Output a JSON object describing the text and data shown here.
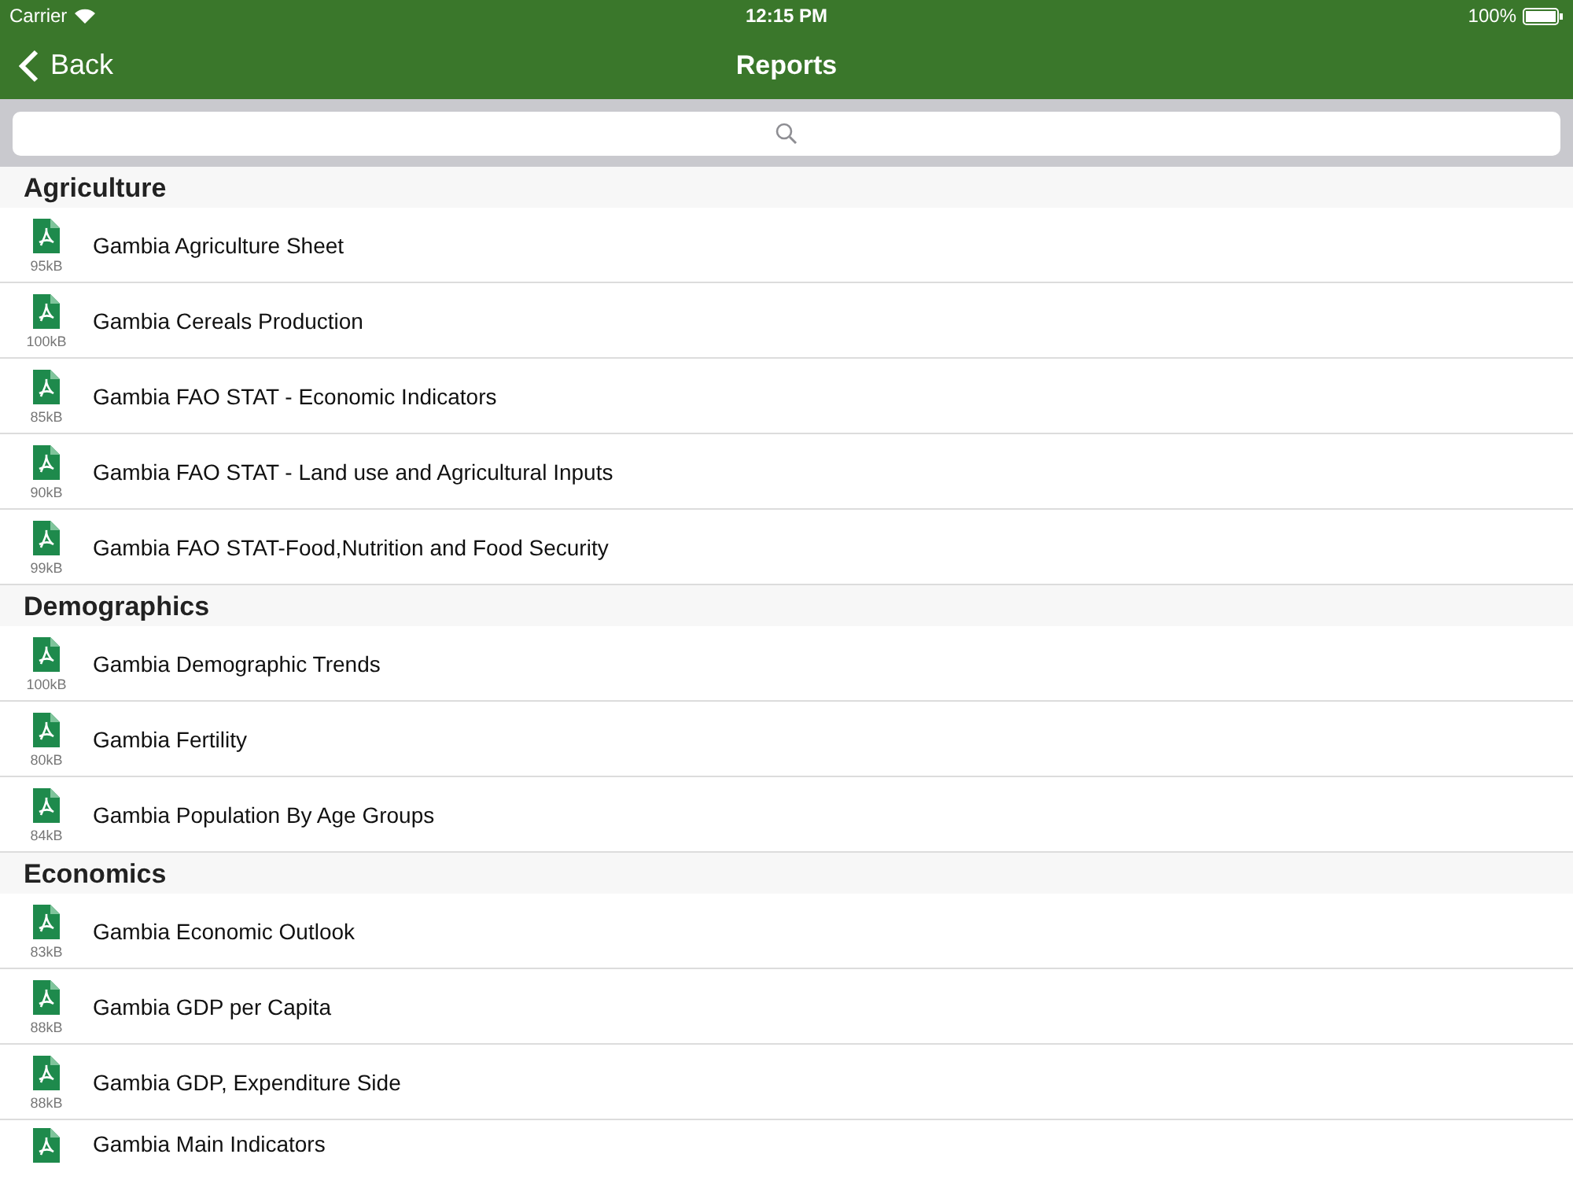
{
  "status_bar": {
    "carrier": "Carrier",
    "time": "12:15 PM",
    "battery": "100%"
  },
  "nav": {
    "back": "Back",
    "title": "Reports"
  },
  "sections": [
    {
      "title": "Agriculture",
      "items": [
        {
          "name": "Gambia Agriculture Sheet",
          "size": "95kB"
        },
        {
          "name": "Gambia Cereals Production",
          "size": "100kB"
        },
        {
          "name": "Gambia FAO STAT - Economic Indicators",
          "size": "85kB"
        },
        {
          "name": "Gambia FAO STAT - Land use and Agricultural Inputs",
          "size": "90kB"
        },
        {
          "name": "Gambia FAO STAT-Food,Nutrition and Food Security",
          "size": "99kB"
        }
      ]
    },
    {
      "title": "Demographics",
      "items": [
        {
          "name": "Gambia Demographic Trends",
          "size": "100kB"
        },
        {
          "name": "Gambia Fertility",
          "size": "80kB"
        },
        {
          "name": "Gambia Population By Age Groups",
          "size": "84kB"
        }
      ]
    },
    {
      "title": "Economics",
      "items": [
        {
          "name": "Gambia Economic Outlook",
          "size": "83kB"
        },
        {
          "name": "Gambia GDP per Capita",
          "size": "88kB"
        },
        {
          "name": "Gambia GDP, Expenditure Side",
          "size": "88kB"
        },
        {
          "name": "Gambia Main Indicators"
        }
      ]
    }
  ]
}
